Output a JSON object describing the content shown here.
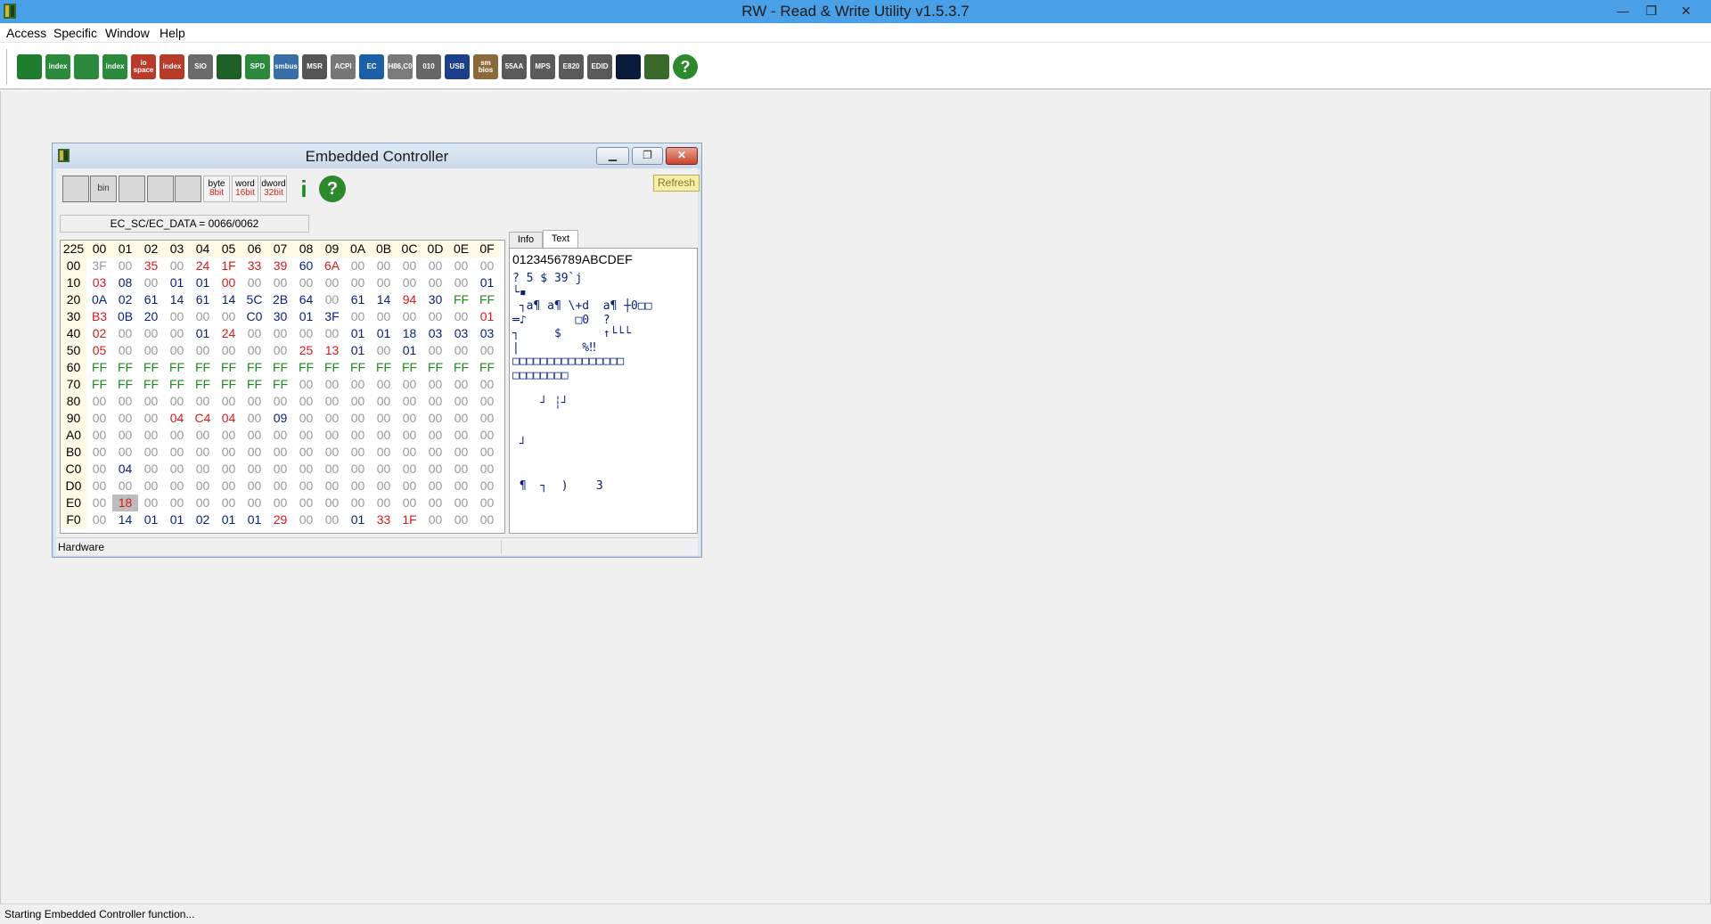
{
  "app": {
    "title": "RW - Read & Write Utility v1.5.3.7",
    "window_controls": [
      "—",
      "❐",
      "✕"
    ]
  },
  "menu": [
    "Access",
    "Specific",
    "Window",
    "Help"
  ],
  "toolbar": [
    {
      "icon": "pci-icon",
      "label": "",
      "color": "#1f7d2e"
    },
    {
      "icon": "pci-index-icon",
      "label": "index",
      "color": "#2b8a3b"
    },
    {
      "icon": "memory-icon",
      "label": "",
      "color": "#2b8a3b"
    },
    {
      "icon": "memory-index-icon",
      "label": "index",
      "color": "#2b8a3b"
    },
    {
      "icon": "io-space-icon",
      "label": "io space",
      "color": "#b83b2a"
    },
    {
      "icon": "io-index-icon",
      "label": "index",
      "color": "#b83b2a"
    },
    {
      "icon": "superio-icon",
      "label": "SIO",
      "color": "#6b6b6b"
    },
    {
      "icon": "waveform-icon",
      "label": "",
      "color": "#1e5f25"
    },
    {
      "icon": "spd-icon",
      "label": "SPD",
      "color": "#2b8a3b"
    },
    {
      "icon": "smbus-icon",
      "label": "smbus",
      "color": "#3a6ea8"
    },
    {
      "icon": "msr-icon",
      "label": "MSR",
      "color": "#555555"
    },
    {
      "icon": "acpi-icon",
      "label": "ACPI",
      "color": "#777777"
    },
    {
      "icon": "ec-icon",
      "label": "EC",
      "color": "#1b5fa8"
    },
    {
      "icon": "disk-icon",
      "label": "H86,C0",
      "color": "#7a7a7a"
    },
    {
      "icon": "ata-icon",
      "label": "010",
      "color": "#666666"
    },
    {
      "icon": "usb-icon",
      "label": "USB",
      "color": "#1b3f8a"
    },
    {
      "icon": "smbios-icon",
      "label": "sm bios",
      "color": "#8a6a3a"
    },
    {
      "icon": "55aa-icon",
      "label": "55AA",
      "color": "#5a5a5a"
    },
    {
      "icon": "mps-icon",
      "label": "MPS",
      "color": "#5a5a5a"
    },
    {
      "icon": "e820-icon",
      "label": "E820",
      "color": "#5a5a5a"
    },
    {
      "icon": "edid-icon",
      "label": "EDID",
      "color": "#5a5a5a"
    },
    {
      "icon": "command-icon",
      "label": "",
      "color": "#0a1a3a"
    },
    {
      "icon": "tools-icon",
      "label": "",
      "color": "#3a6a2a"
    },
    {
      "icon": "help-icon",
      "label": "?",
      "color": "#2c8a2c"
    }
  ],
  "status": "Starting Embedded Controller function...",
  "ec_window": {
    "title": "Embedded Controller",
    "refresh": "Refresh",
    "info_line": "EC_SC/EC_DATA = 0066/0062",
    "status": "Hardware",
    "tabs": [
      "Info",
      "Text"
    ],
    "toolbar": [
      {
        "icon": "save-icon",
        "label": ""
      },
      {
        "icon": "save-bin-icon",
        "label": "bin"
      },
      {
        "icon": "load-icon",
        "label": ""
      },
      {
        "icon": "find-icon",
        "label": ""
      },
      {
        "icon": "compare-icon",
        "label": ""
      },
      {
        "icon": "byte-icon",
        "label": "byte",
        "sub": "8bit"
      },
      {
        "icon": "word-icon",
        "label": "word",
        "sub": "16bit"
      },
      {
        "icon": "dword-icon",
        "label": "dword",
        "sub": "32bit"
      },
      {
        "icon": "info-icon",
        "label": "i"
      },
      {
        "icon": "help-icon",
        "label": "?"
      }
    ],
    "hex": {
      "corner": "225",
      "columns": [
        "00",
        "01",
        "02",
        "03",
        "04",
        "05",
        "06",
        "07",
        "08",
        "09",
        "0A",
        "0B",
        "0C",
        "0D",
        "0E",
        "0F"
      ],
      "rows": [
        {
          "addr": "00",
          "cells": [
            "3F",
            "00",
            "35",
            "00",
            "24",
            "1F",
            "33",
            "39",
            "60",
            "6A",
            "00",
            "00",
            "00",
            "00",
            "00",
            "00"
          ]
        },
        {
          "addr": "10",
          "cells": [
            "03",
            "08",
            "00",
            "01",
            "01",
            "00",
            "00",
            "00",
            "00",
            "00",
            "00",
            "00",
            "00",
            "00",
            "00",
            "01"
          ]
        },
        {
          "addr": "20",
          "cells": [
            "0A",
            "02",
            "61",
            "14",
            "61",
            "14",
            "5C",
            "2B",
            "64",
            "00",
            "61",
            "14",
            "94",
            "30",
            "FF",
            "FF"
          ]
        },
        {
          "addr": "30",
          "cells": [
            "B3",
            "0B",
            "20",
            "00",
            "00",
            "00",
            "C0",
            "30",
            "01",
            "3F",
            "00",
            "00",
            "00",
            "00",
            "00",
            "01"
          ]
        },
        {
          "addr": "40",
          "cells": [
            "02",
            "00",
            "00",
            "00",
            "01",
            "24",
            "00",
            "00",
            "00",
            "00",
            "01",
            "01",
            "18",
            "03",
            "03",
            "03"
          ]
        },
        {
          "addr": "50",
          "cells": [
            "05",
            "00",
            "00",
            "00",
            "00",
            "00",
            "00",
            "00",
            "25",
            "13",
            "01",
            "00",
            "01",
            "00",
            "00",
            "00"
          ]
        },
        {
          "addr": "60",
          "cells": [
            "FF",
            "FF",
            "FF",
            "FF",
            "FF",
            "FF",
            "FF",
            "FF",
            "FF",
            "FF",
            "FF",
            "FF",
            "FF",
            "FF",
            "FF",
            "FF"
          ]
        },
        {
          "addr": "70",
          "cells": [
            "FF",
            "FF",
            "FF",
            "FF",
            "FF",
            "FF",
            "FF",
            "FF",
            "00",
            "00",
            "00",
            "00",
            "00",
            "00",
            "00",
            "00"
          ]
        },
        {
          "addr": "80",
          "cells": [
            "00",
            "00",
            "00",
            "00",
            "00",
            "00",
            "00",
            "00",
            "00",
            "00",
            "00",
            "00",
            "00",
            "00",
            "00",
            "00"
          ]
        },
        {
          "addr": "90",
          "cells": [
            "00",
            "00",
            "00",
            "04",
            "C4",
            "04",
            "00",
            "09",
            "00",
            "00",
            "00",
            "00",
            "00",
            "00",
            "00",
            "00"
          ]
        },
        {
          "addr": "A0",
          "cells": [
            "00",
            "00",
            "00",
            "00",
            "00",
            "00",
            "00",
            "00",
            "00",
            "00",
            "00",
            "00",
            "00",
            "00",
            "00",
            "00"
          ]
        },
        {
          "addr": "B0",
          "cells": [
            "00",
            "00",
            "00",
            "00",
            "00",
            "00",
            "00",
            "00",
            "00",
            "00",
            "00",
            "00",
            "00",
            "00",
            "00",
            "00"
          ]
        },
        {
          "addr": "C0",
          "cells": [
            "00",
            "04",
            "00",
            "00",
            "00",
            "00",
            "00",
            "00",
            "00",
            "00",
            "00",
            "00",
            "00",
            "00",
            "00",
            "00"
          ]
        },
        {
          "addr": "D0",
          "cells": [
            "00",
            "00",
            "00",
            "00",
            "00",
            "00",
            "00",
            "00",
            "00",
            "00",
            "00",
            "00",
            "00",
            "00",
            "00",
            "00"
          ]
        },
        {
          "addr": "E0",
          "cells": [
            "00",
            "18",
            "00",
            "00",
            "00",
            "00",
            "00",
            "00",
            "00",
            "00",
            "00",
            "00",
            "00",
            "00",
            "00",
            "00"
          ]
        },
        {
          "addr": "F0",
          "cells": [
            "00",
            "14",
            "01",
            "01",
            "02",
            "01",
            "01",
            "29",
            "00",
            "00",
            "01",
            "33",
            "1F",
            "00",
            "00",
            "00"
          ]
        }
      ],
      "colors": {
        "00": [
          "gray",
          "gray",
          "red",
          "gray",
          "red",
          "red",
          "red",
          "red",
          "blue",
          "red",
          "gray",
          "gray",
          "gray",
          "gray",
          "gray",
          "gray"
        ],
        "10": [
          "red",
          "blue",
          "gray",
          "blue",
          "blue",
          "red",
          "gray",
          "gray",
          "gray",
          "gray",
          "gray",
          "gray",
          "gray",
          "gray",
          "gray",
          "blue"
        ],
        "20": [
          "blue",
          "blue",
          "blue",
          "blue",
          "blue",
          "blue",
          "blue",
          "blue",
          "blue",
          "gray",
          "blue",
          "blue",
          "red",
          "blue",
          "green",
          "green"
        ],
        "30": [
          "red",
          "blue",
          "blue",
          "gray",
          "gray",
          "gray",
          "blue",
          "blue",
          "blue",
          "blue",
          "gray",
          "gray",
          "gray",
          "gray",
          "gray",
          "red"
        ],
        "40": [
          "red",
          "gray",
          "gray",
          "gray",
          "blue",
          "red",
          "gray",
          "gray",
          "gray",
          "gray",
          "blue",
          "blue",
          "blue",
          "blue",
          "blue",
          "blue"
        ],
        "50": [
          "red",
          "gray",
          "gray",
          "gray",
          "gray",
          "gray",
          "gray",
          "gray",
          "red",
          "red",
          "blue",
          "gray",
          "blue",
          "gray",
          "gray",
          "gray"
        ],
        "60": [
          "green",
          "green",
          "green",
          "green",
          "green",
          "green",
          "green",
          "green",
          "green",
          "green",
          "green",
          "green",
          "green",
          "green",
          "green",
          "green"
        ],
        "70": [
          "green",
          "green",
          "green",
          "green",
          "green",
          "green",
          "green",
          "green",
          "gray",
          "gray",
          "gray",
          "gray",
          "gray",
          "gray",
          "gray",
          "gray"
        ],
        "90": [
          "gray",
          "gray",
          "gray",
          "red",
          "red",
          "red",
          "gray",
          "blue",
          "gray",
          "gray",
          "gray",
          "gray",
          "gray",
          "gray",
          "gray",
          "gray"
        ],
        "C0": [
          "gray",
          "blue",
          "gray",
          "gray",
          "gray",
          "gray",
          "gray",
          "gray",
          "gray",
          "gray",
          "gray",
          "gray",
          "gray",
          "gray",
          "gray",
          "gray"
        ],
        "E0": [
          "gray",
          "red",
          "gray",
          "gray",
          "gray",
          "gray",
          "gray",
          "gray",
          "gray",
          "gray",
          "gray",
          "gray",
          "gray",
          "gray",
          "gray",
          "gray"
        ],
        "F0": [
          "gray",
          "blue",
          "blue",
          "blue",
          "blue",
          "blue",
          "blue",
          "red",
          "gray",
          "gray",
          "blue",
          "red",
          "red",
          "gray",
          "gray",
          "gray"
        ]
      },
      "selected": {
        "row": "E0",
        "col": 1
      }
    },
    "text": {
      "header": "0123456789ABCDEF",
      "rows": [
        "? 5 $ 39`j",
        "└▪",
        " ┐a¶ a¶ \\+d  a¶ ┼0□□",
        "═♪       □0  ?",
        "┐     $      ↑└└└",
        "|         %‼",
        "□□□□□□□□□□□□□□□□",
        "□□□□□□□□",
        "",
        "    ┘ ┆┘",
        "",
        "",
        " ┘",
        "",
        "",
        " ¶  ┐  )    3"
      ]
    }
  }
}
